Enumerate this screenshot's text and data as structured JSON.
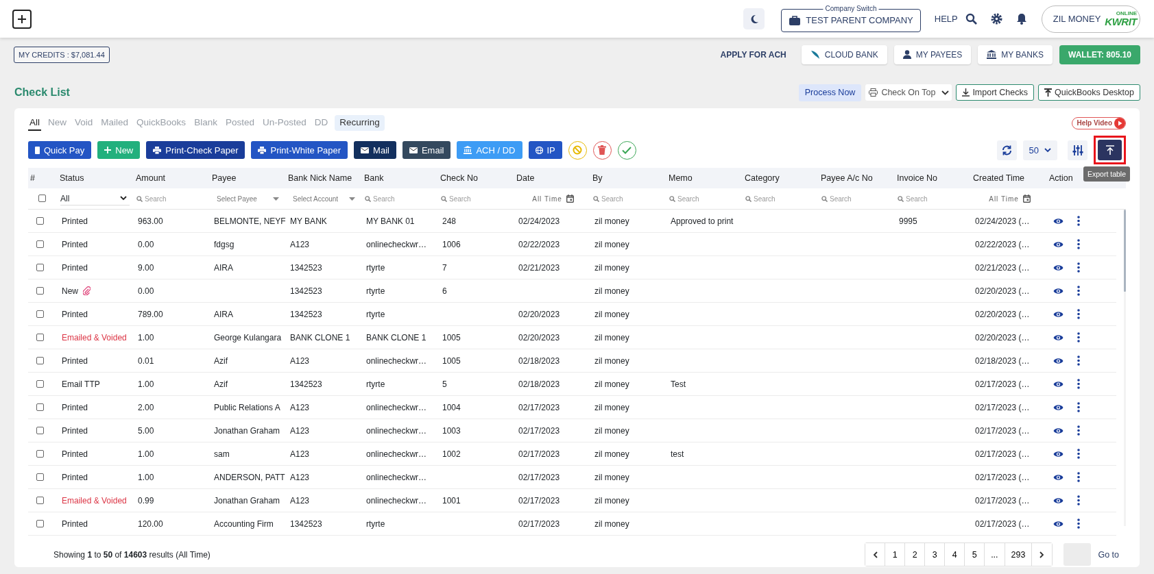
{
  "header": {
    "company_switch": {
      "legend": "Company Switch",
      "name": "TEST PARENT COMPANY"
    },
    "help": "HELP",
    "account": {
      "name": "ZIL MONEY",
      "logo_small": "ONLINE",
      "logo_main": "KWRIT"
    }
  },
  "credits": "MY CREDITS : $7,081.44",
  "quick_links": [
    {
      "label": "APPLY FOR ACH",
      "kind": "link"
    },
    {
      "label": "CLOUD BANK",
      "kind": "cloud"
    },
    {
      "label": "MY PAYEES",
      "kind": "person"
    },
    {
      "label": "MY BANKS",
      "kind": "bank"
    },
    {
      "label": "WALLET: 805.10",
      "kind": "wallet"
    }
  ],
  "page_title": "Check List",
  "title_actions": [
    {
      "label": "Process Now",
      "kind": "process"
    },
    {
      "label": "Check On Top",
      "kind": "select"
    },
    {
      "label": "Import Checks",
      "kind": "import"
    },
    {
      "label": "QuickBooks Desktop",
      "kind": "export"
    }
  ],
  "tabs": [
    {
      "label": "All",
      "selected": true,
      "highlighted": false
    },
    {
      "label": "New",
      "selected": false,
      "highlighted": false
    },
    {
      "label": "Void",
      "selected": false,
      "highlighted": false
    },
    {
      "label": "Mailed",
      "selected": false,
      "highlighted": false
    },
    {
      "label": "QuickBooks",
      "selected": false,
      "highlighted": false
    },
    {
      "label": "Blank",
      "selected": false,
      "highlighted": false
    },
    {
      "label": "Posted",
      "selected": false,
      "highlighted": false
    },
    {
      "label": "Un-Posted",
      "selected": false,
      "highlighted": false
    },
    {
      "label": "DD",
      "selected": false,
      "highlighted": false
    },
    {
      "label": "Recurring",
      "selected": false,
      "highlighted": true
    }
  ],
  "help_video": "Help Video",
  "actions": [
    {
      "label": "Quick Pay",
      "kind": "quickpay"
    },
    {
      "label": "New",
      "kind": "new"
    },
    {
      "label": "Print-Check Paper",
      "kind": "print"
    },
    {
      "label": "Print-White Paper",
      "kind": "print2"
    },
    {
      "label": "Mail",
      "kind": "mail"
    },
    {
      "label": "Email",
      "kind": "email"
    },
    {
      "label": "ACH / DD",
      "kind": "ach"
    },
    {
      "label": "IP",
      "kind": "ip"
    },
    {
      "kind": "void"
    },
    {
      "kind": "delete"
    },
    {
      "kind": "approve"
    }
  ],
  "page_size": "50",
  "export": {
    "tooltip": "Export table",
    "highlighted": true
  },
  "table": {
    "columns": [
      "#",
      "Status",
      "Amount",
      "Payee",
      "Bank Nick Name",
      "Bank",
      "Check No",
      "Date",
      "By",
      "Memo",
      "Category",
      "Payee A/c No",
      "Invoice No",
      "Created Time",
      "Action"
    ],
    "filters": [
      {
        "kind": "checkbox",
        "checked": false
      },
      {
        "kind": "select",
        "text": "All"
      },
      {
        "kind": "search",
        "text": "Search"
      },
      {
        "kind": "dropdown",
        "text": "Select Payee"
      },
      {
        "kind": "dropdown",
        "text": "Select Account"
      },
      {
        "kind": "search",
        "text": "Search"
      },
      {
        "kind": "search",
        "text": "Search"
      },
      {
        "kind": "date",
        "text": "All Time"
      },
      {
        "kind": "search",
        "text": "Search"
      },
      {
        "kind": "search",
        "text": "Search"
      },
      {
        "kind": "search",
        "text": "Search"
      },
      {
        "kind": "search",
        "text": "Search"
      },
      {
        "kind": "search",
        "text": "Search"
      },
      {
        "kind": "date",
        "text": "All Time"
      },
      {
        "kind": "none"
      }
    ],
    "rows": [
      {
        "checked": false,
        "color": "#212529",
        "attachment": false,
        "cells": [
          "",
          "Printed",
          "963.00",
          "BELMONTE, NEYF",
          "MY BANK",
          "MY BANK 01",
          "248",
          "02/24/2023",
          "zil money",
          "Approved to print",
          "",
          "",
          "9995",
          "02/24/2023 (…",
          ""
        ]
      },
      {
        "checked": false,
        "color": "#212529",
        "attachment": false,
        "cells": [
          "",
          "Printed",
          "0.00",
          "fdgsg",
          "A123",
          "onlinecheckwr…",
          "1006",
          "02/22/2023",
          "zil money",
          "",
          "",
          "",
          "",
          "02/22/2023 (…",
          ""
        ]
      },
      {
        "checked": false,
        "color": "#212529",
        "attachment": false,
        "cells": [
          "",
          "Printed",
          "9.00",
          "AIRA",
          "1342523",
          "rtyrte",
          "7",
          "02/21/2023",
          "zil money",
          "",
          "",
          "",
          "",
          "02/21/2023 (…",
          ""
        ]
      },
      {
        "checked": false,
        "color": "#212529",
        "attachment": true,
        "cells": [
          "",
          "New",
          "0.00",
          "",
          "1342523",
          "rtyrte",
          "6",
          "",
          "zil money",
          "",
          "",
          "",
          "",
          "02/20/2023 (…",
          ""
        ]
      },
      {
        "checked": false,
        "color": "#212529",
        "attachment": false,
        "cells": [
          "",
          "Printed",
          "789.00",
          "AIRA",
          "1342523",
          "rtyrte",
          "",
          "02/20/2023",
          "zil money",
          "",
          "",
          "",
          "",
          "02/20/2023 (…",
          ""
        ]
      },
      {
        "checked": false,
        "color": "#dc3545",
        "attachment": false,
        "cells": [
          "",
          "Emailed & Voided",
          "1.00",
          "George Kulangara",
          "BANK CLONE 1",
          "BANK CLONE 1",
          "1005",
          "02/20/2023",
          "zil money",
          "",
          "",
          "",
          "",
          "02/20/2023 (…",
          ""
        ]
      },
      {
        "checked": false,
        "color": "#212529",
        "attachment": false,
        "cells": [
          "",
          "Printed",
          "0.01",
          "Azif",
          "A123",
          "onlinecheckwr…",
          "1005",
          "02/18/2023",
          "zil money",
          "",
          "",
          "",
          "",
          "02/18/2023 (…",
          ""
        ]
      },
      {
        "checked": false,
        "color": "#212529",
        "attachment": false,
        "cells": [
          "",
          "Email TTP",
          "1.00",
          "Azif",
          "1342523",
          "rtyrte",
          "5",
          "02/18/2023",
          "zil money",
          "Test",
          "",
          "",
          "",
          "02/17/2023 (…",
          ""
        ]
      },
      {
        "checked": false,
        "color": "#212529",
        "attachment": false,
        "cells": [
          "",
          "Printed",
          "2.00",
          "Public Relations A",
          "A123",
          "onlinecheckwr…",
          "1004",
          "02/17/2023",
          "zil money",
          "",
          "",
          "",
          "",
          "02/17/2023 (…",
          ""
        ]
      },
      {
        "checked": false,
        "color": "#212529",
        "attachment": false,
        "cells": [
          "",
          "Printed",
          "5.00",
          "Jonathan Graham",
          "A123",
          "onlinecheckwr…",
          "1003",
          "02/17/2023",
          "zil money",
          "",
          "",
          "",
          "",
          "02/17/2023 (…",
          ""
        ]
      },
      {
        "checked": false,
        "color": "#212529",
        "attachment": false,
        "cells": [
          "",
          "Printed",
          "1.00",
          "sam",
          "A123",
          "onlinecheckwr…",
          "1002",
          "02/17/2023",
          "zil money",
          "test",
          "",
          "",
          "",
          "02/17/2023 (…",
          ""
        ]
      },
      {
        "checked": false,
        "color": "#212529",
        "attachment": false,
        "cells": [
          "",
          "Printed",
          "1.00",
          "ANDERSON, PATT",
          "A123",
          "onlinecheckwr…",
          "",
          "02/17/2023",
          "zil money",
          "",
          "",
          "",
          "",
          "02/17/2023 (…",
          ""
        ]
      },
      {
        "checked": false,
        "color": "#dc3545",
        "attachment": false,
        "cells": [
          "",
          "Emailed & Voided",
          "0.99",
          "Jonathan Graham",
          "A123",
          "onlinecheckwr…",
          "1001",
          "02/17/2023",
          "zil money",
          "",
          "",
          "",
          "",
          "02/17/2023 (…",
          ""
        ]
      },
      {
        "checked": false,
        "color": "#212529",
        "attachment": false,
        "cells": [
          "",
          "Printed",
          "120.00",
          "Accounting Firm",
          "1342523",
          "rtyrte",
          "",
          "02/17/2023",
          "zil money",
          "",
          "",
          "",
          "",
          "02/17/2023 (…",
          ""
        ]
      }
    ]
  },
  "footer": {
    "summary": "Showing **1** to **50** of **14603** results (All Time)",
    "pages": [
      {
        "label": "1",
        "selected": false
      },
      {
        "label": "2",
        "selected": false
      },
      {
        "label": "3",
        "selected": false
      },
      {
        "label": "4",
        "selected": false
      },
      {
        "label": "5",
        "selected": false
      },
      {
        "label": "...",
        "selected": false
      },
      {
        "label": "293",
        "selected": false
      }
    ],
    "goto": "Go to"
  }
}
